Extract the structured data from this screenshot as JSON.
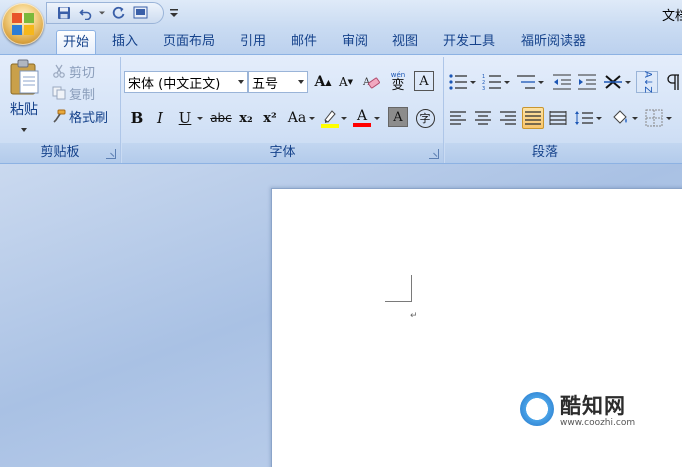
{
  "title": "文档",
  "qat": {
    "save": "save-icon",
    "undo": "undo-icon",
    "redo": "redo-icon",
    "print_preview": "print-preview-icon"
  },
  "tabs": [
    "开始",
    "插入",
    "页面布局",
    "引用",
    "邮件",
    "审阅",
    "视图",
    "开发工具",
    "福昕阅读器"
  ],
  "clipboard": {
    "paste": "粘贴",
    "cut": "剪切",
    "copy": "复制",
    "format_painter": "格式刷",
    "group_label": "剪贴板"
  },
  "font": {
    "name": "宋体 (中文正文)",
    "size": "五号",
    "group_label": "字体",
    "bold": "B",
    "italic": "I",
    "underline": "U",
    "strike": "abc",
    "sub": "x₂",
    "sup": "x²",
    "case": "Aa",
    "grow": "A",
    "shrink": "A",
    "char_border": "A",
    "char_shade": "A",
    "enclose": "字",
    "phonetic_top": "wén",
    "phonetic": "变"
  },
  "paragraph": {
    "group_label": "段落",
    "sort": "A↓Z"
  },
  "document": {
    "paragraph_mark": "↵"
  },
  "watermark": {
    "title": "酷知网",
    "url": "www.coozhi.com"
  },
  "colors": {
    "highlight": "#ffff00",
    "font_color": "#ff0000",
    "accent": "#15428b"
  }
}
